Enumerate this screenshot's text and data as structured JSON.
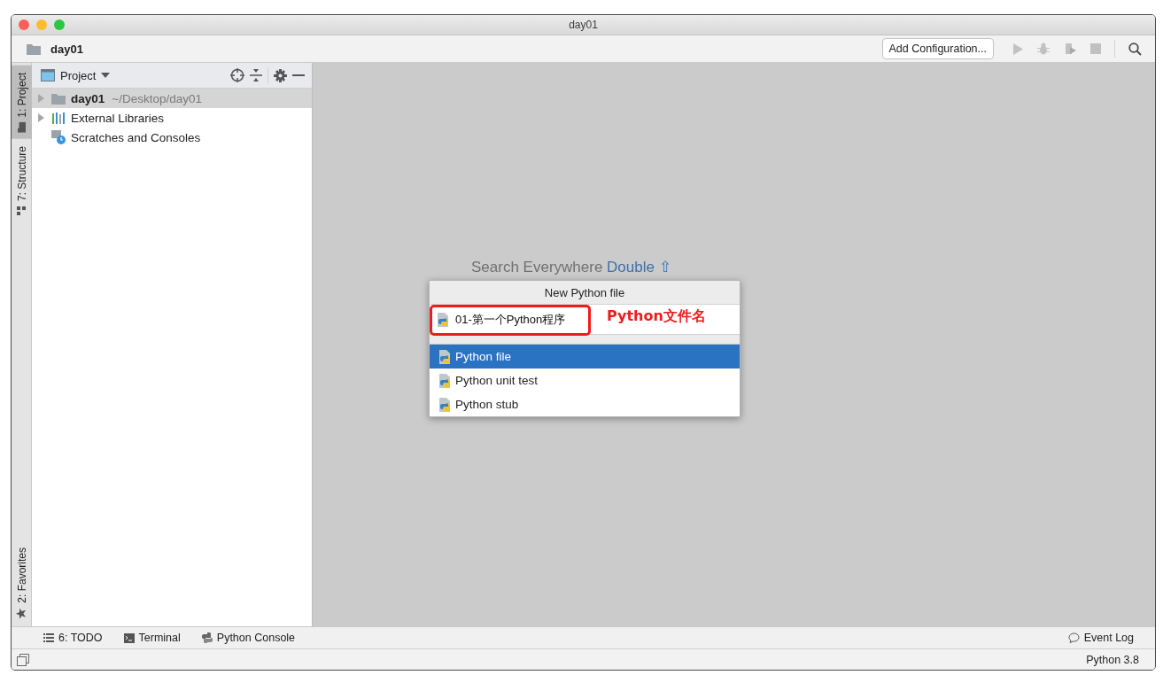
{
  "window": {
    "title": "day01"
  },
  "navbar": {
    "project": "day01",
    "run_config": "Add Configuration..."
  },
  "left_stripe": {
    "tabs": [
      {
        "label": "1: Project",
        "kind": "project",
        "selected": true
      },
      {
        "label": "7: Structure",
        "kind": "structure",
        "selected": false
      }
    ],
    "bottom_tabs": [
      {
        "label": "2: Favorites",
        "kind": "favorites",
        "selected": false
      }
    ]
  },
  "project_panel": {
    "title": "Project",
    "tree": [
      {
        "label": "day01",
        "path": "~/Desktop/day01",
        "kind": "folder",
        "selected": true,
        "expanded": false
      },
      {
        "label": "External Libraries",
        "kind": "libraries",
        "selected": false,
        "expanded": false
      },
      {
        "label": "Scratches and Consoles",
        "kind": "scratches",
        "selected": false
      }
    ]
  },
  "editor": {
    "hint": "Search Everywhere",
    "shortcut": "Double ⇧"
  },
  "popup": {
    "title": "New Python file",
    "value": "01-第一个Python程序",
    "options": [
      {
        "label": "Python file",
        "selected": true
      },
      {
        "label": "Python unit test",
        "selected": false
      },
      {
        "label": "Python stub",
        "selected": false
      }
    ]
  },
  "annotation": {
    "label": "Python文件名"
  },
  "bottom_tools": [
    {
      "label": "6: TODO",
      "kind": "todo"
    },
    {
      "label": "Terminal",
      "kind": "terminal"
    },
    {
      "label": "Python Console",
      "kind": "console"
    }
  ],
  "event_log": "Event Log",
  "status_bar": {
    "interpreter": "Python 3.8"
  }
}
